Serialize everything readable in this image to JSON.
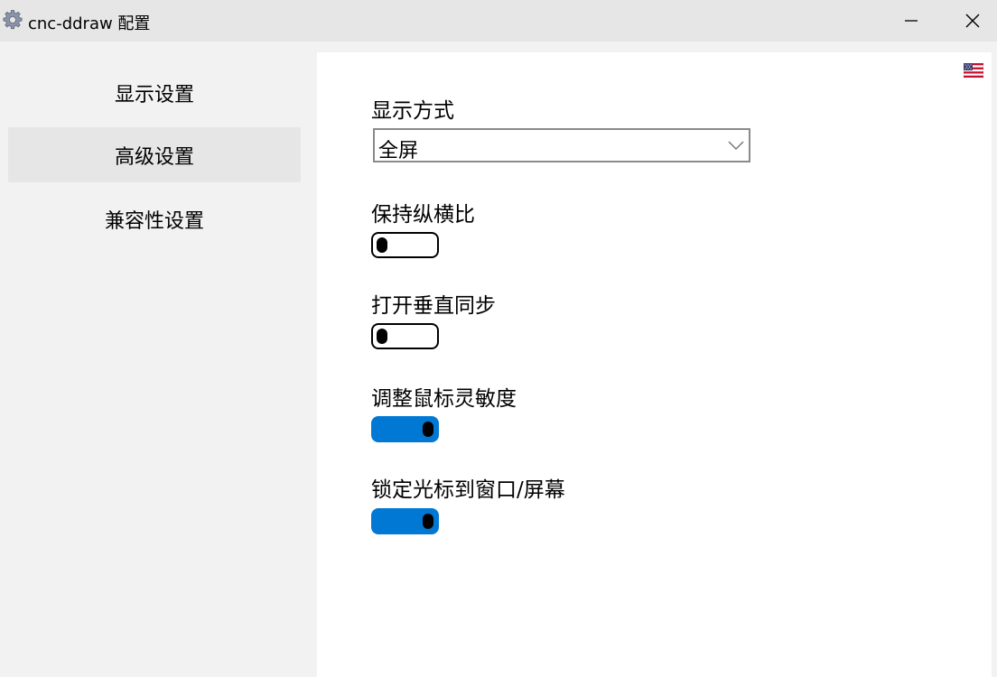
{
  "window": {
    "title": "cnc-ddraw 配置",
    "app_icon": "gear-icon",
    "minimize_icon": "minimize-icon",
    "close_icon": "close-icon"
  },
  "sidebar": {
    "items": [
      {
        "label": "显示设置",
        "selected": false
      },
      {
        "label": "高级设置",
        "selected": true
      },
      {
        "label": "兼容性设置",
        "selected": false
      }
    ]
  },
  "content": {
    "language_icon": "us-flag-icon",
    "display_mode": {
      "label": "显示方式",
      "value": "全屏"
    },
    "toggles": [
      {
        "label": "保持纵横比",
        "on": false
      },
      {
        "label": "打开垂直同步",
        "on": false
      },
      {
        "label": "调整鼠标灵敏度",
        "on": true
      },
      {
        "label": "锁定光标到窗口/屏幕",
        "on": true
      }
    ]
  },
  "colors": {
    "accent": "#0078d4",
    "titlebar": "#e6e6e6",
    "sidebar_bg": "#f2f2f2",
    "selected_item": "#e6e6e6",
    "content_bg": "#ffffff"
  }
}
